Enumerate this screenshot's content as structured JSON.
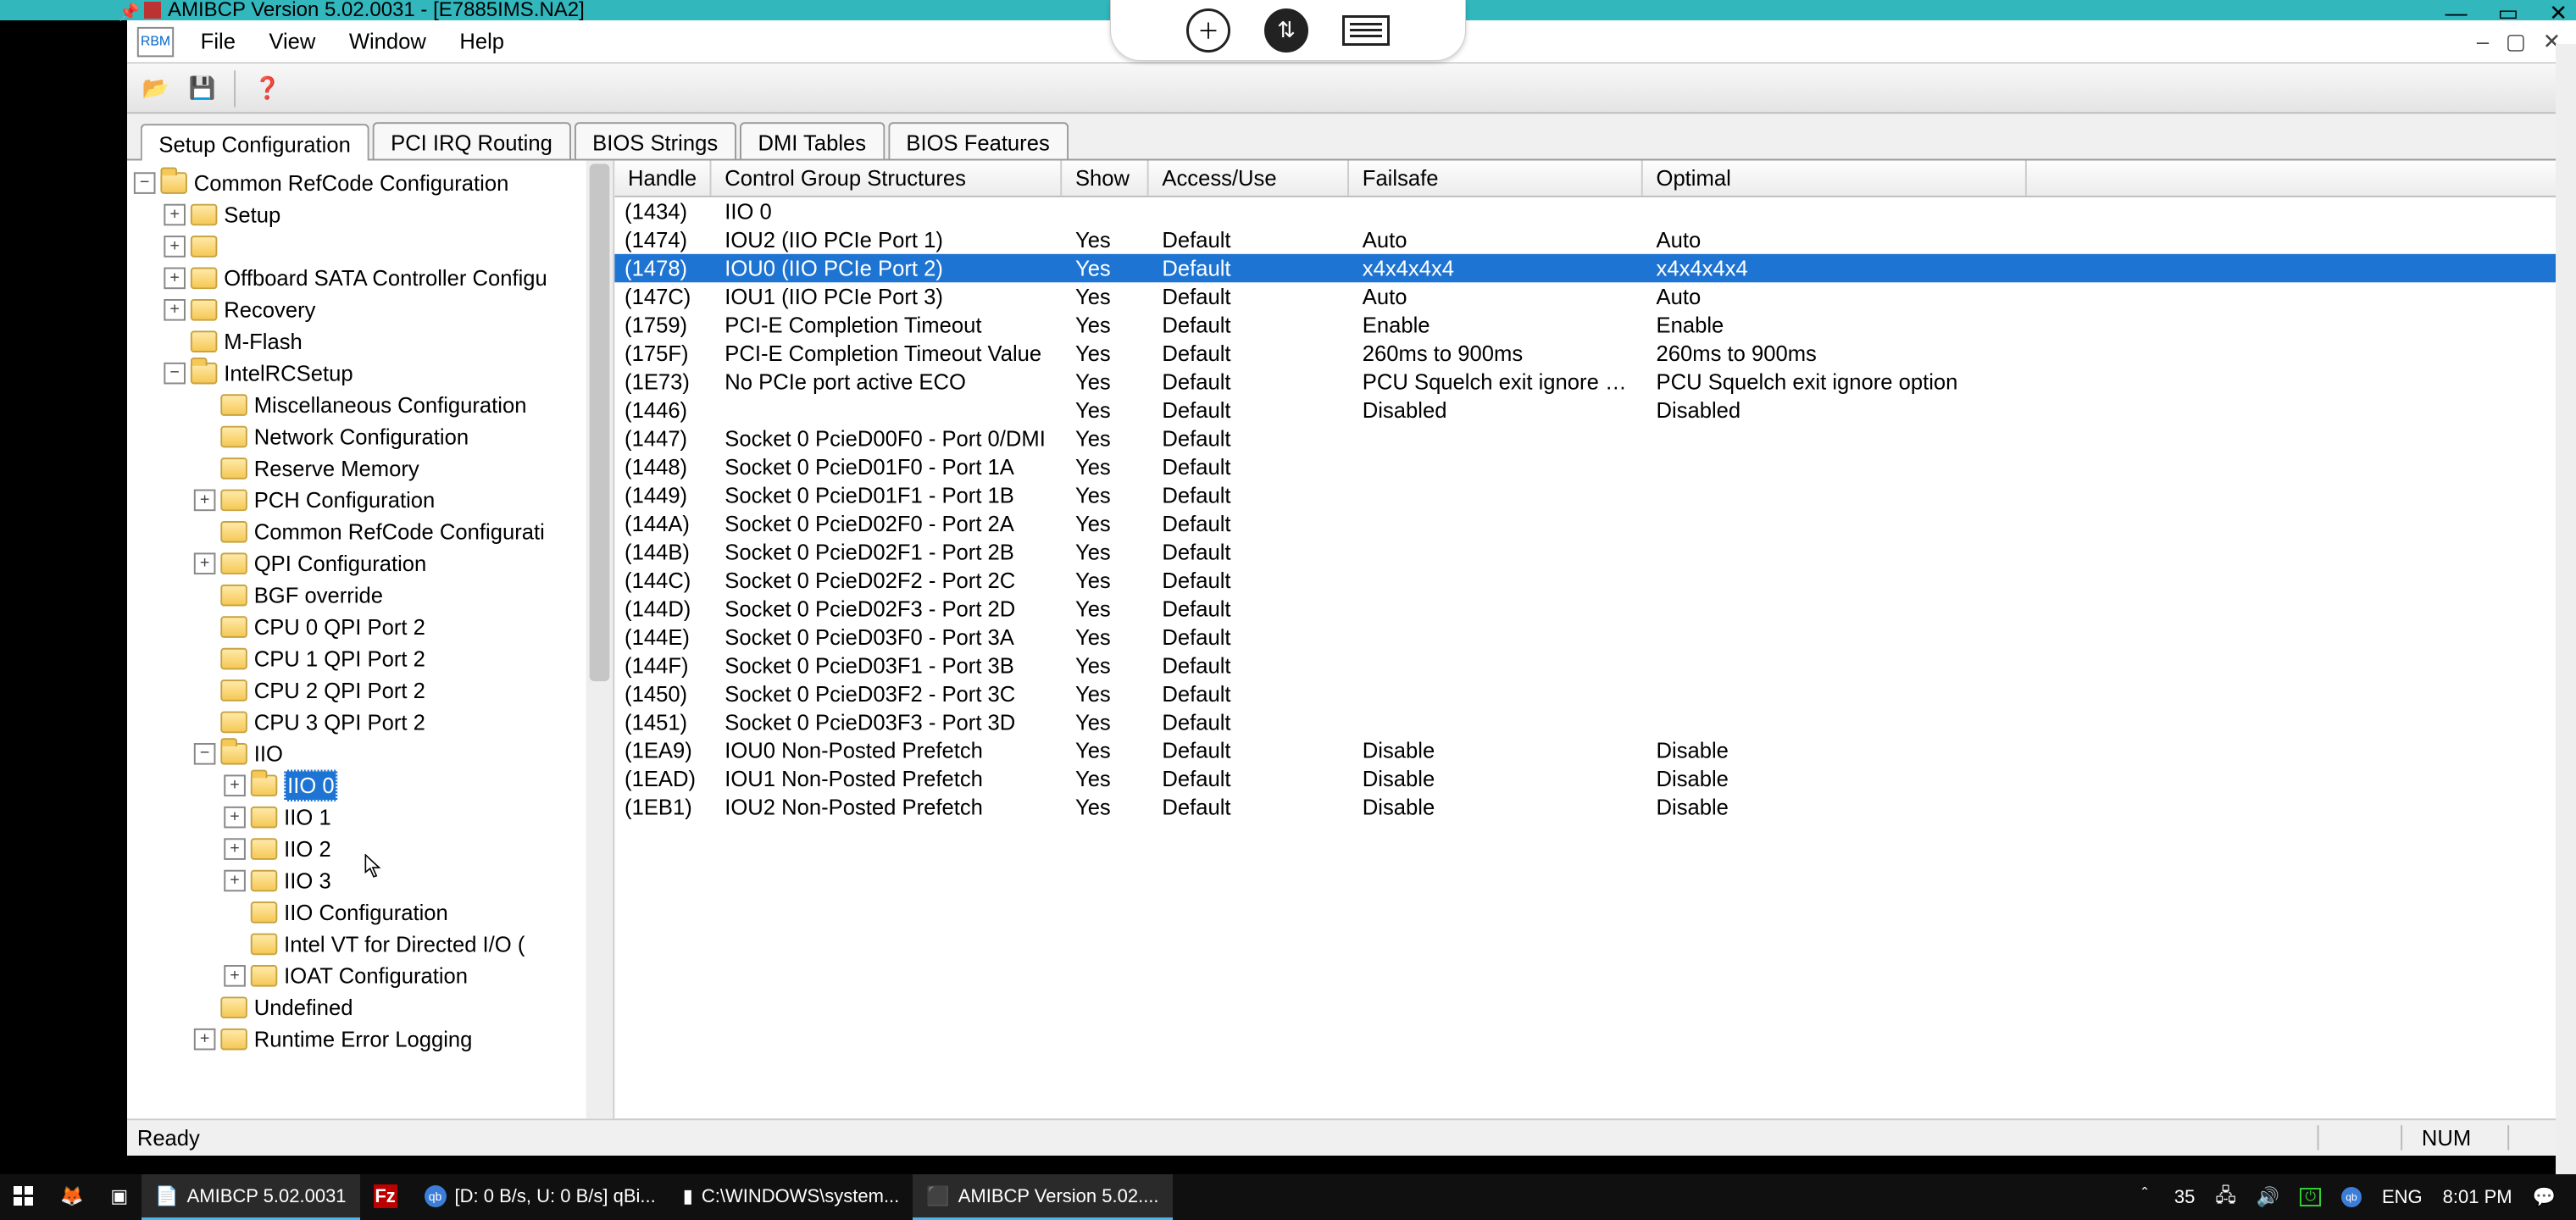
{
  "rdp": {
    "title": "AMIBCP Version 5.02.0031 - [E7885IMS.NA2]",
    "min": "—",
    "max": "▭",
    "close": "✕"
  },
  "menu": {
    "file": "File",
    "view": "View",
    "window": "Window",
    "help": "Help",
    "mdimin": "–",
    "mdimax": "▢",
    "mdiclose": "✕",
    "appIcon": "RBM"
  },
  "toolbar": {
    "open": "📂",
    "save": "💾",
    "help": "❓"
  },
  "tabs": {
    "setup": "Setup Configuration",
    "irq": "PCI IRQ Routing",
    "strings": "BIOS Strings",
    "dmi": "DMI Tables",
    "features": "BIOS Features"
  },
  "tree": {
    "root": "Common RefCode Configuration",
    "setup": "Setup",
    "blank": "",
    "offboard": "Offboard SATA Controller Configu",
    "recovery": "Recovery",
    "mflash": "M-Flash",
    "intelrc": "IntelRCSetup",
    "misc": "Miscellaneous Configuration",
    "net": "Network Configuration",
    "reserve": "Reserve Memory",
    "pch": "PCH Configuration",
    "commonrc": "Common RefCode Configurati",
    "qpi": "QPI Configuration",
    "bgf": "BGF override",
    "cpu0": "CPU 0 QPI Port 2",
    "cpu1": "CPU 1 QPI Port 2",
    "cpu2": "CPU 2 QPI Port 2",
    "cpu3": "CPU 3 QPI Port 2",
    "iio": "IIO",
    "iio0": "IIO 0",
    "iio1": "IIO 1",
    "iio2": "IIO 2",
    "iio3": "IIO 3",
    "iiocfg": "IIO Configuration",
    "vtd": "Intel VT for Directed I/O (",
    "ioat": "IOAT Configuration",
    "undef": "Undefined",
    "rel": "Runtime Error Logging"
  },
  "grid": {
    "headers": {
      "handle": "Handle",
      "cgs": "Control Group Structures",
      "show": "Show",
      "au": "Access/Use",
      "fs": "Failsafe",
      "opt": "Optimal"
    },
    "rows": [
      {
        "handle": "(1434)",
        "cgs": "IIO 0",
        "show": "",
        "au": "",
        "fs": "",
        "opt": ""
      },
      {
        "handle": "(1474)",
        "cgs": "IOU2 (IIO PCIe Port 1)",
        "show": "Yes",
        "au": "Default",
        "fs": "Auto",
        "opt": "Auto"
      },
      {
        "handle": "(1478)",
        "cgs": "IOU0 (IIO PCIe Port 2)",
        "show": "Yes",
        "au": "Default",
        "fs": "x4x4x4x4",
        "opt": "x4x4x4x4",
        "sel": true
      },
      {
        "handle": "(147C)",
        "cgs": "IOU1 (IIO PCIe Port 3)",
        "show": "Yes",
        "au": "Default",
        "fs": "Auto",
        "opt": "Auto"
      },
      {
        "handle": "(1759)",
        "cgs": "PCI-E Completion Timeout",
        "show": "Yes",
        "au": "Default",
        "fs": "Enable",
        "opt": "Enable"
      },
      {
        "handle": "(175F)",
        "cgs": "PCI-E Completion Timeout Value",
        "show": "Yes",
        "au": "Default",
        "fs": "260ms to 900ms",
        "opt": "260ms to 900ms"
      },
      {
        "handle": "(1E73)",
        "cgs": "No PCIe port active ECO",
        "show": "Yes",
        "au": "Default",
        "fs": "PCU Squelch exit ignore o...",
        "opt": "PCU Squelch exit ignore option"
      },
      {
        "handle": "(1446)",
        "cgs": "",
        "show": "Yes",
        "au": "Default",
        "fs": "Disabled",
        "opt": "Disabled"
      },
      {
        "handle": "(1447)",
        "cgs": "Socket 0 PcieD00F0 - Port 0/DMI",
        "show": "Yes",
        "au": "Default",
        "fs": "",
        "opt": ""
      },
      {
        "handle": "(1448)",
        "cgs": "Socket 0 PcieD01F0 - Port 1A",
        "show": "Yes",
        "au": "Default",
        "fs": "",
        "opt": ""
      },
      {
        "handle": "(1449)",
        "cgs": "Socket 0 PcieD01F1 - Port 1B",
        "show": "Yes",
        "au": "Default",
        "fs": "",
        "opt": ""
      },
      {
        "handle": "(144A)",
        "cgs": "Socket 0 PcieD02F0 - Port 2A",
        "show": "Yes",
        "au": "Default",
        "fs": "",
        "opt": ""
      },
      {
        "handle": "(144B)",
        "cgs": "Socket 0 PcieD02F1 - Port 2B",
        "show": "Yes",
        "au": "Default",
        "fs": "",
        "opt": ""
      },
      {
        "handle": "(144C)",
        "cgs": "Socket 0 PcieD02F2 - Port 2C",
        "show": "Yes",
        "au": "Default",
        "fs": "",
        "opt": ""
      },
      {
        "handle": "(144D)",
        "cgs": "Socket 0 PcieD02F3 - Port 2D",
        "show": "Yes",
        "au": "Default",
        "fs": "",
        "opt": ""
      },
      {
        "handle": "(144E)",
        "cgs": "Socket 0 PcieD03F0 - Port 3A",
        "show": "Yes",
        "au": "Default",
        "fs": "",
        "opt": ""
      },
      {
        "handle": "(144F)",
        "cgs": "Socket 0 PcieD03F1 - Port 3B",
        "show": "Yes",
        "au": "Default",
        "fs": "",
        "opt": ""
      },
      {
        "handle": "(1450)",
        "cgs": "Socket 0 PcieD03F2 - Port 3C",
        "show": "Yes",
        "au": "Default",
        "fs": "",
        "opt": ""
      },
      {
        "handle": "(1451)",
        "cgs": "Socket 0 PcieD03F3 - Port 3D",
        "show": "Yes",
        "au": "Default",
        "fs": "",
        "opt": ""
      },
      {
        "handle": "(1EA9)",
        "cgs": "IOU0 Non-Posted Prefetch",
        "show": "Yes",
        "au": "Default",
        "fs": "Disable",
        "opt": "Disable"
      },
      {
        "handle": "(1EAD)",
        "cgs": "IOU1 Non-Posted Prefetch",
        "show": "Yes",
        "au": "Default",
        "fs": "Disable",
        "opt": "Disable"
      },
      {
        "handle": "(1EB1)",
        "cgs": "IOU2 Non-Posted Prefetch",
        "show": "Yes",
        "au": "Default",
        "fs": "Disable",
        "opt": "Disable"
      }
    ]
  },
  "status": {
    "ready": "Ready",
    "num": "NUM"
  },
  "taskbar": {
    "amibcp": "AMIBCP 5.02.0031",
    "qbit": "[D: 0 B/s, U: 0 B/s] qBi...",
    "cmd": "C:\\WINDOWS\\system...",
    "amibcp2": "AMIBCP Version 5.02....",
    "temp": "35",
    "lang": "ENG",
    "time": "8:01 PM",
    "chev": "＾"
  },
  "pill": {
    "plus": "＋",
    "arrows": "⇅"
  }
}
